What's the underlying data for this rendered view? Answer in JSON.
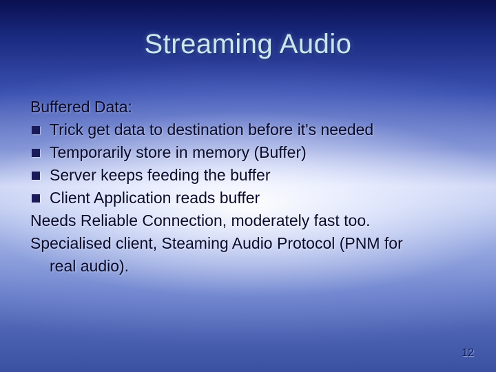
{
  "title": "Streaming Audio",
  "body": {
    "intro": "Buffered Data:",
    "bullets": [
      "Trick get data to destination before it's needed",
      "Temporarily store in memory (Buffer)",
      "Server keeps feeding the buffer",
      "Client Application reads buffer"
    ],
    "outro1": "Needs Reliable Connection, moderately fast too.",
    "outro2_line1": "Specialised client, Steaming Audio Protocol (PNM for",
    "outro2_line2": "real audio)."
  },
  "page_number": "12"
}
